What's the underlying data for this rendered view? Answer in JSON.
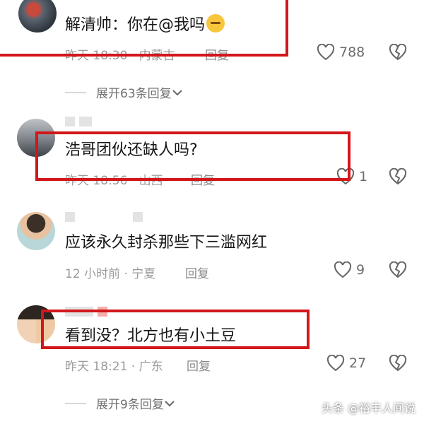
{
  "comments": [
    {
      "text": "解清帅：你在@我吗",
      "meta": "昨天 18:30 · 内蒙古",
      "reply": "回复",
      "likes": "788",
      "expand": "展开63条回复"
    },
    {
      "text": "浩哥团伙还缺人吗?",
      "meta": "昨天 18:56 · 山西",
      "reply": "回复",
      "likes": "1"
    },
    {
      "text": "应该永久封杀那些下三滥网红",
      "meta": "12 小时前 · 宁夏",
      "reply": "回复",
      "likes": "9"
    },
    {
      "text": "看到没？北方也有小土豆",
      "meta": "昨天 18:21 · 广东",
      "reply": "回复",
      "likes": "27",
      "expand": "展开9条回复"
    }
  ],
  "watermark": "头条 @裕丰人间说",
  "colors": {
    "highlight": "#d2171a",
    "meta": "#9a9a9a",
    "text": "#161616"
  },
  "icons": [
    "heart-icon",
    "broken-heart-icon",
    "chevron-down-icon"
  ]
}
